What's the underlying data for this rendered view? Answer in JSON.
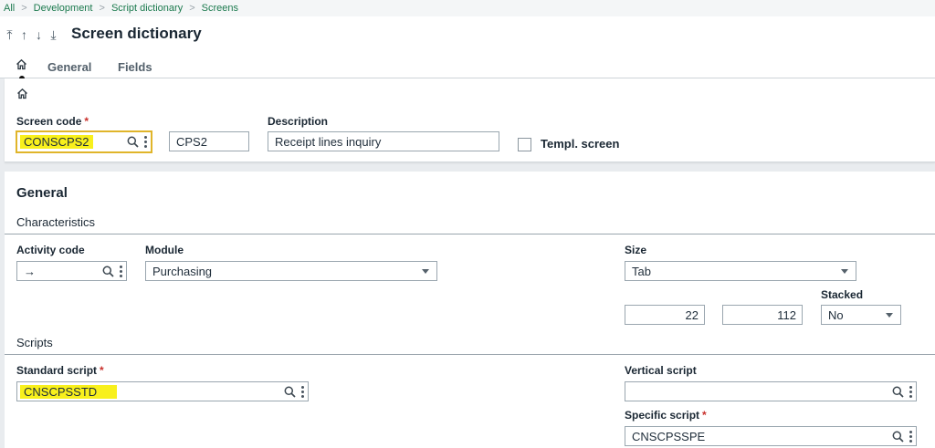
{
  "breadcrumb": [
    "All",
    "Development",
    "Script dictionary",
    "Screens"
  ],
  "title": "Screen dictionary",
  "tabs": {
    "general": "General",
    "fields": "Fields"
  },
  "header": {
    "screen_code_label": "Screen code",
    "screen_code_value": "CONSCPS2",
    "short_code_value": "CPS2",
    "description_label": "Description",
    "description_value": "Receipt lines inquiry",
    "templ_screen_label": "Templ. screen"
  },
  "general": {
    "title": "General",
    "characteristics_title": "Characteristics",
    "activity_code_label": "Activity code",
    "activity_code_value": "→",
    "module_label": "Module",
    "module_value": "Purchasing",
    "size_label": "Size",
    "size_value": "Tab",
    "size_width": "22",
    "size_height": "112",
    "stacked_label": "Stacked",
    "stacked_value": "No",
    "scripts_title": "Scripts",
    "standard_script_label": "Standard script",
    "standard_script_value": "CNSCPSSTD",
    "vertical_script_label": "Vertical script",
    "vertical_script_value": "",
    "specific_script_label": "Specific script",
    "specific_script_value": "CNSCPSSPE"
  },
  "required_marker": "*",
  "colors": {
    "accent_green": "#1c7a4e",
    "highlight": "#f8f01c",
    "focus_border": "#e0b52a",
    "required": "#c9302c"
  },
  "icons": [
    "first-record-icon",
    "previous-record-icon",
    "next-record-icon",
    "last-record-icon",
    "home-icon",
    "search-icon",
    "more-options-icon",
    "dropdown-caret-icon"
  ]
}
